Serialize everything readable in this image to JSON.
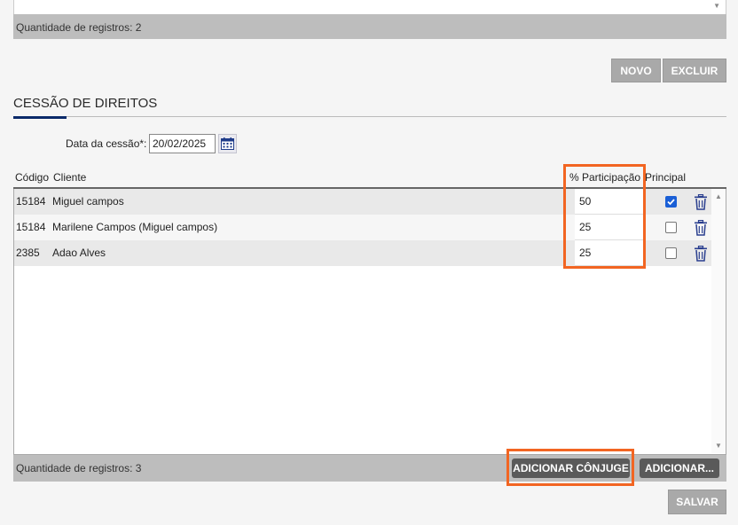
{
  "top_list": {
    "record_count": "Quantidade de registros: 2"
  },
  "toolbar": {
    "novo_label": "NOVO",
    "excluir_label": "EXCLUIR"
  },
  "section": {
    "title": "CESSÃO DE DIREITOS"
  },
  "date": {
    "label": "Data da cessão*:",
    "value": "20/02/2025"
  },
  "table": {
    "headers": {
      "codigo": "Código",
      "cliente": "Cliente",
      "participacao": "% Participação",
      "principal": "Principal"
    },
    "rows": [
      {
        "codigo": "15184",
        "cliente": "Miguel campos",
        "participacao": "50",
        "principal": true
      },
      {
        "codigo": "15184",
        "cliente": "Marilene Campos (Miguel campos)",
        "participacao": "25",
        "principal": false
      },
      {
        "codigo": "2385",
        "cliente": "Adao Alves",
        "participacao": "25",
        "principal": false
      }
    ],
    "record_count": "Quantidade de registros: 3"
  },
  "actions": {
    "adicionar_conjuge_label": "ADICIONAR CÔNJUGE",
    "adicionar_label": "ADICIONAR...",
    "salvar_label": "SALVAR"
  },
  "icons": {
    "calendar": "calendar-icon",
    "trash": "trash-icon",
    "checkbox_checked": "checkbox-checked",
    "scroll_up": "scroll-up-arrow",
    "scroll_down": "scroll-down-arrow"
  },
  "colors": {
    "highlight": "#f26522",
    "accent": "#0b2a6a",
    "checkbox": "#1a5fd6",
    "button_dark": "#5a5a5a",
    "button_gray": "#a9a9a9"
  }
}
